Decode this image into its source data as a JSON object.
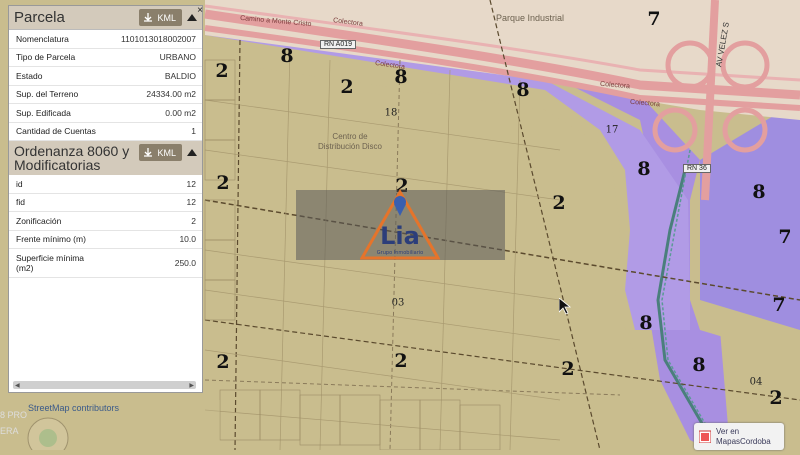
{
  "panel": {
    "parcela_title": "Parcela",
    "kml_label": "KML",
    "close_symbol": "×",
    "parcela_rows": [
      {
        "key": "Nomenclatura",
        "value": "1101013018002007"
      },
      {
        "key": "Tipo de Parcela",
        "value": "URBANO"
      },
      {
        "key": "Estado",
        "value": "BALDIO"
      },
      {
        "key": "Sup. del Terreno",
        "value": "24334.00 m2"
      },
      {
        "key": "Sup. Edificada",
        "value": "0.00 m2"
      },
      {
        "key": "Cantidad de Cuentas",
        "value": "1"
      }
    ],
    "ordenanza_title": "Ordenanza 8060 y Modificatorias",
    "ordenanza_rows": [
      {
        "key": "id",
        "value": "12"
      },
      {
        "key": "fid",
        "value": "12"
      },
      {
        "key": "Zonificación",
        "value": "2"
      },
      {
        "key": "Frente mínimo (m)",
        "value": "10.0"
      },
      {
        "key": "Superficie mínima (m2)",
        "value": "250.0"
      }
    ]
  },
  "map": {
    "zone_labels": [
      "8",
      "2",
      "8",
      "8",
      "7",
      "8",
      "2",
      "8",
      "8",
      "7",
      "2",
      "2",
      "2",
      "7",
      "8",
      "2",
      "8",
      "2",
      "2",
      "2",
      "2"
    ],
    "parcel_numbers": [
      "18",
      "17",
      "03",
      "04"
    ],
    "road_labels": [
      "Colectora",
      "Colectora",
      "Colectora",
      "Colectora",
      "AV VELEZ S",
      "Camino a Monte Cristo"
    ],
    "route_shields": [
      "RN A019",
      "RN 36"
    ],
    "place_labels": [
      "Centro de Distribución Disco",
      "Parque Industrial"
    ],
    "colors": {
      "zone_8": "#a78ce6",
      "zone_7": "#9f8ee0",
      "zone_2": "#c9bd8e",
      "highway": "#e9a6a6"
    }
  },
  "watermark": {
    "brand": "Lia",
    "subtitle": "Grupo Inmobiliario"
  },
  "footer": {
    "osm_credit": "StreetMap contributors",
    "phone_overlay_1": "8 PRO",
    "phone_overlay_2": "ERA"
  },
  "button": {
    "line1": "Ver en",
    "line2": "MapasCordoba"
  }
}
